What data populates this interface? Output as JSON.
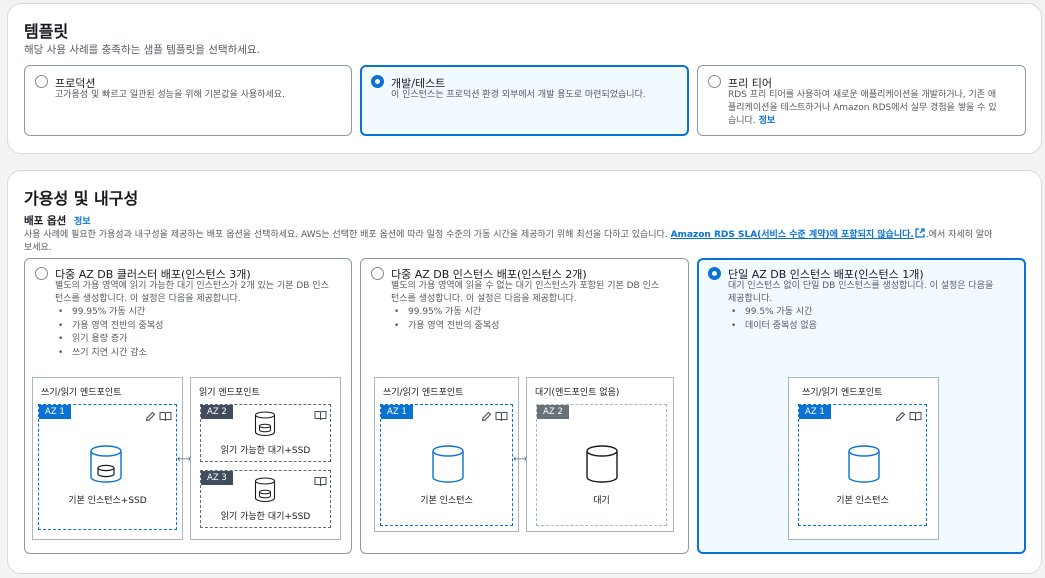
{
  "template": {
    "title": "템플릿",
    "description": "해당 사용 사례를 충족하는 샘플 템플릿을 선택하세요.",
    "options": [
      {
        "title": "프로덕션",
        "desc": "고가용성 및 빠르고 일관된 성능을 위해 기본값을 사용하세요."
      },
      {
        "title": "개발/테스트",
        "desc": "이 인스턴스는 프로덕션 환경 외부에서 개발 용도로 마련되었습니다."
      },
      {
        "title": "프리 티어",
        "desc_line1": "RDS 프리 티어를 사용하여 새로운 애플리케이션을 개발하거나, 기존 애",
        "desc_line2": "플리케이션을 테스트하거나 Amazon RDS에서 실무 경험을 쌓을 수 있",
        "desc_line3": "습니다.",
        "info": "정보"
      }
    ]
  },
  "availability": {
    "title": "가용성 및 내구성",
    "deploy_label": "배포 옵션",
    "info": "정보",
    "desc_line1": "사용 사례에 필요한 가용성과 내구성을 제공하는 배포 옵션을 선택하세요. AWS는 선택한 배포 옵션에 따라 일정 수준의 가동 시간을 제공하기 위해 최선을 다하고 있습니다.",
    "sla_link": "Amazon RDS SLA(서비스 수준 계약)에 포함되지 않습니다.",
    "desc_tail": ".에서 자세히 알아",
    "desc_line2": "보세요.",
    "options": [
      {
        "title": "다중 AZ DB 클러스터 배포(인스턴스 3개)",
        "desc_line1": "별도의 가용 영역에 읽기 가능한 대기 인스턴스가 2개 있는 기본 DB 인스",
        "desc_line2": "턴스를 생성합니다. 이 설정은 다음을 제공합니다.",
        "bullets": [
          "99.95% 가동 시간",
          "가용 영역 전반의 중복성",
          "읽기 용량 증가",
          "쓰기 지연 시간 감소"
        ],
        "box1_title": "쓰기/읽기 엔드포인트",
        "box2_title": "읽기 엔드포인트",
        "az1": "AZ 1",
        "az2": "AZ 2",
        "az3": "AZ 3",
        "primary_label": "기본 인스턴스+SSD",
        "standby_label1": "읽기 가능한 대기+SSD",
        "standby_label2": "읽기 가능한 대기+SSD"
      },
      {
        "title": "다중 AZ DB 인스턴스 배포(인스턴스 2개)",
        "desc_line1": "별도의 가용 영역에 읽을 수 없는 대기 인스턴스가 포함된 기본 DB 인스",
        "desc_line2": "턴스를 생성합니다. 이 설정은 다음을 제공합니다.",
        "bullets": [
          "99.95% 가동 시간",
          "가용 영역 전반의 중복성"
        ],
        "box1_title": "쓰기/읽기 엔드포인트",
        "box2_title": "대기(엔드포인트 없음)",
        "az1": "AZ 1",
        "az2": "AZ 2",
        "primary_label": "기본 인스턴스",
        "standby_label": "대기"
      },
      {
        "title": "단일 AZ DB 인스턴스 배포(인스턴스 1개)",
        "desc_line1": "대기 인스턴스 없이 단일 DB 인스턴스를 생성합니다. 이 설정은 다음을",
        "desc_line2": "제공합니다.",
        "bullets": [
          "99.5% 가동 시간",
          "데이터 중복성 없음"
        ],
        "box1_title": "쓰기/읽기 엔드포인트",
        "az1": "AZ 1",
        "primary_label": "기본 인스턴스"
      }
    ]
  },
  "colors": {
    "accent": "#0972d3",
    "selected_bg": "#f1faff",
    "border": "#8d99a8"
  },
  "icons": [
    "pencil-icon",
    "book-icon",
    "database-icon",
    "external-link-icon",
    "bidirectional-arrow-icon"
  ]
}
